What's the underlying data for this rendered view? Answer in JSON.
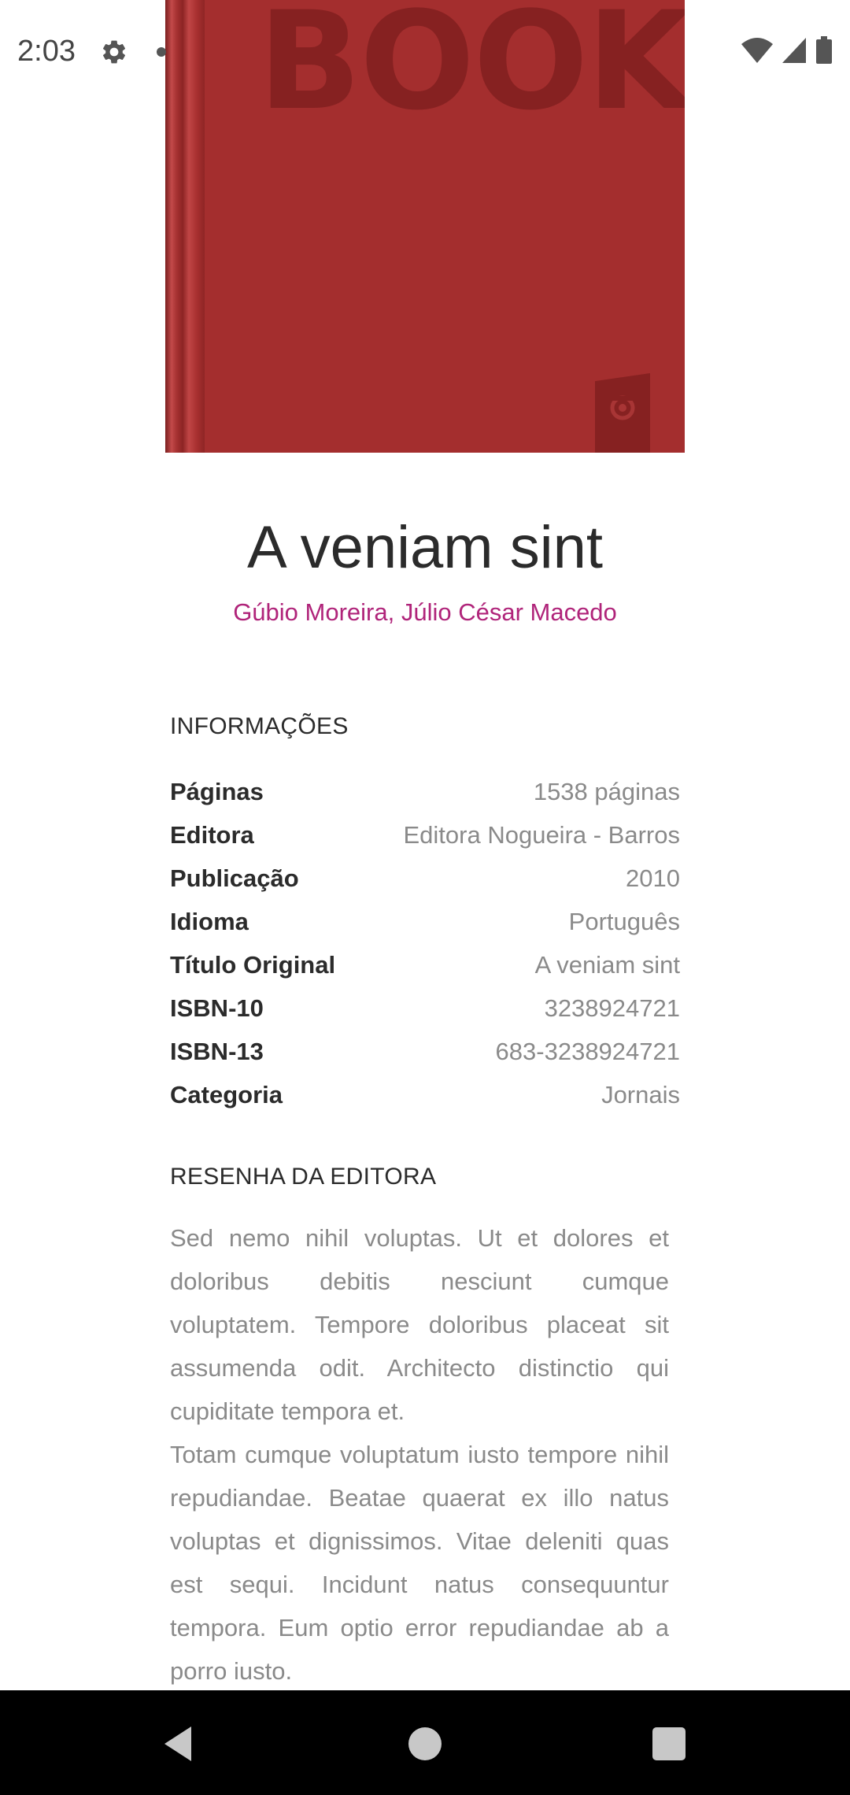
{
  "status_bar": {
    "time": "2:03",
    "icons": [
      "settings-gear-icon",
      "notification-dot-icon",
      "wifi-icon",
      "cellular-signal-icon",
      "battery-icon"
    ]
  },
  "cover": {
    "text": "BOOK",
    "color": "#a42e2e",
    "emblem_icon": "publisher-emblem-icon"
  },
  "book": {
    "title": "A veniam sint",
    "authors": "Gúbio Moreira, Júlio César Macedo"
  },
  "info": {
    "heading": "INFORMAÇÕES",
    "rows": [
      {
        "label": "Páginas",
        "value": "1538 páginas"
      },
      {
        "label": "Editora",
        "value": "Editora Nogueira - Barros"
      },
      {
        "label": "Publicação",
        "value": "2010"
      },
      {
        "label": "Idioma",
        "value": "Português"
      },
      {
        "label": "Título Original",
        "value": "A veniam sint"
      },
      {
        "label": "ISBN-10",
        "value": "3238924721"
      },
      {
        "label": "ISBN-13",
        "value": "683-3238924721"
      },
      {
        "label": "Categoria",
        "value": "Jornais"
      }
    ]
  },
  "review": {
    "heading": "RESENHA DA EDITORA",
    "text": "Sed nemo nihil voluptas. Ut et dolores et doloribus debitis nesciunt cumque voluptatem. Tempore doloribus placeat sit assumenda odit. Architecto distinctio qui cupiditate tempora et.\n  Totam cumque voluptatum iusto tempore nihil repudiandae. Beatae quaerat ex illo natus voluptas et dignissimos. Vitae deleniti quas est sequi. Incidunt natus consequuntur tempora. Eum optio error repudiandae ab a porro iusto."
  },
  "nav_bar": {
    "buttons": [
      "back-icon",
      "home-icon",
      "recents-icon"
    ]
  },
  "colors": {
    "accent": "#b0247a",
    "cover": "#a42e2e",
    "text_primary": "#2b2b2b",
    "text_secondary": "#8a8a8a"
  }
}
